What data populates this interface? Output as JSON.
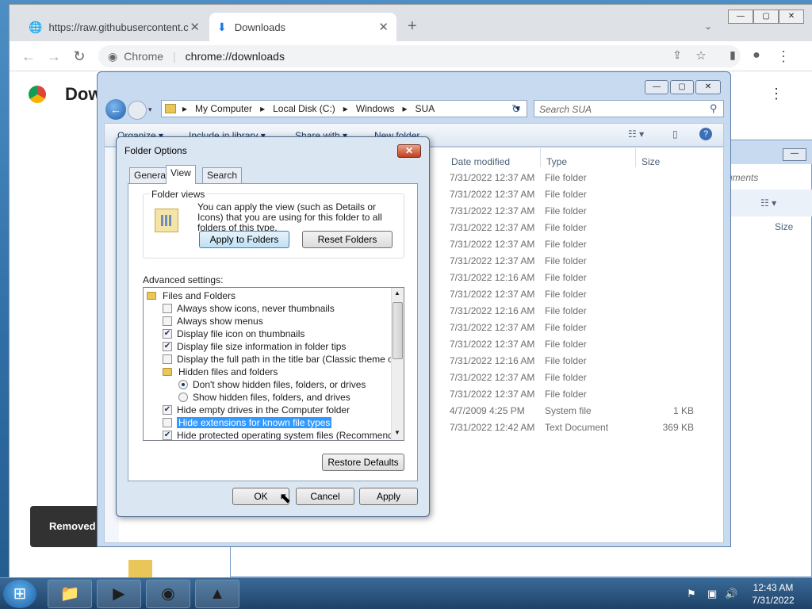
{
  "chrome": {
    "tabs": [
      {
        "label": "https://raw.githubusercontent.co",
        "icon": "globe-icon"
      },
      {
        "label": "Downloads",
        "icon": "download-icon"
      }
    ],
    "new_tab": "+",
    "url_label": "Chrome",
    "url": "chrome://downloads",
    "page_title": "Dow",
    "toast": "Removed '"
  },
  "explorer": {
    "breadcrumb": [
      "My Computer",
      "Local Disk (C:)",
      "Windows",
      "SUA"
    ],
    "search_placeholder": "Search SUA",
    "toolbar": [
      "Organize ▾",
      "Include in library ▾",
      "Share with ▾",
      "New folder"
    ],
    "columns": [
      "Date modified",
      "Type",
      "Size"
    ],
    "rows": [
      {
        "date": "7/31/2022 12:37 AM",
        "type": "File folder",
        "size": ""
      },
      {
        "date": "7/31/2022 12:37 AM",
        "type": "File folder",
        "size": ""
      },
      {
        "date": "7/31/2022 12:37 AM",
        "type": "File folder",
        "size": ""
      },
      {
        "date": "7/31/2022 12:37 AM",
        "type": "File folder",
        "size": ""
      },
      {
        "date": "7/31/2022 12:37 AM",
        "type": "File folder",
        "size": ""
      },
      {
        "date": "7/31/2022 12:37 AM",
        "type": "File folder",
        "size": ""
      },
      {
        "date": "7/31/2022 12:16 AM",
        "type": "File folder",
        "size": ""
      },
      {
        "date": "7/31/2022 12:37 AM",
        "type": "File folder",
        "size": ""
      },
      {
        "date": "7/31/2022 12:16 AM",
        "type": "File folder",
        "size": ""
      },
      {
        "date": "7/31/2022 12:37 AM",
        "type": "File folder",
        "size": ""
      },
      {
        "date": "7/31/2022 12:37 AM",
        "type": "File folder",
        "size": ""
      },
      {
        "date": "7/31/2022 12:16 AM",
        "type": "File folder",
        "size": ""
      },
      {
        "date": "7/31/2022 12:37 AM",
        "type": "File folder",
        "size": ""
      },
      {
        "date": "7/31/2022 12:37 AM",
        "type": "File folder",
        "size": ""
      },
      {
        "date": "4/7/2009 4:25 PM",
        "type": "System file",
        "size": "1 KB"
      },
      {
        "date": "7/31/2022 12:42 AM",
        "type": "Text Document",
        "size": "369 KB"
      }
    ],
    "back_window": {
      "crumb": "cuments",
      "size_col": "Size"
    }
  },
  "dialog": {
    "title": "Folder Options",
    "tabs": [
      "General",
      "View",
      "Search"
    ],
    "folder_views": {
      "label": "Folder views",
      "text": "You can apply the view (such as Details or Icons) that you are using for this folder to all folders of this type.",
      "apply": "Apply to Folders",
      "reset": "Reset Folders"
    },
    "advanced_label": "Advanced settings:",
    "advanced": [
      {
        "kind": "folder",
        "label": "Files and Folders",
        "indent": 0
      },
      {
        "kind": "check",
        "label": "Always show icons, never thumbnails",
        "checked": false,
        "indent": 1
      },
      {
        "kind": "check",
        "label": "Always show menus",
        "checked": false,
        "indent": 1
      },
      {
        "kind": "check",
        "label": "Display file icon on thumbnails",
        "checked": true,
        "indent": 1
      },
      {
        "kind": "check",
        "label": "Display file size information in folder tips",
        "checked": true,
        "indent": 1
      },
      {
        "kind": "check",
        "label": "Display the full path in the title bar (Classic theme only)",
        "checked": false,
        "indent": 1
      },
      {
        "kind": "folder",
        "label": "Hidden files and folders",
        "indent": 1
      },
      {
        "kind": "radio",
        "label": "Don't show hidden files, folders, or drives",
        "checked": true,
        "indent": 2
      },
      {
        "kind": "radio",
        "label": "Show hidden files, folders, and drives",
        "checked": false,
        "indent": 2
      },
      {
        "kind": "check",
        "label": "Hide empty drives in the Computer folder",
        "checked": true,
        "indent": 1
      },
      {
        "kind": "check",
        "label": "Hide extensions for known file types",
        "checked": false,
        "indent": 1,
        "selected": true
      },
      {
        "kind": "check",
        "label": "Hide protected operating system files (Recommended)",
        "checked": true,
        "indent": 1
      }
    ],
    "restore": "Restore Defaults",
    "ok": "OK",
    "cancel": "Cancel",
    "apply": "Apply"
  },
  "taskbar": {
    "time": "12:43 AM",
    "date": "7/31/2022"
  }
}
